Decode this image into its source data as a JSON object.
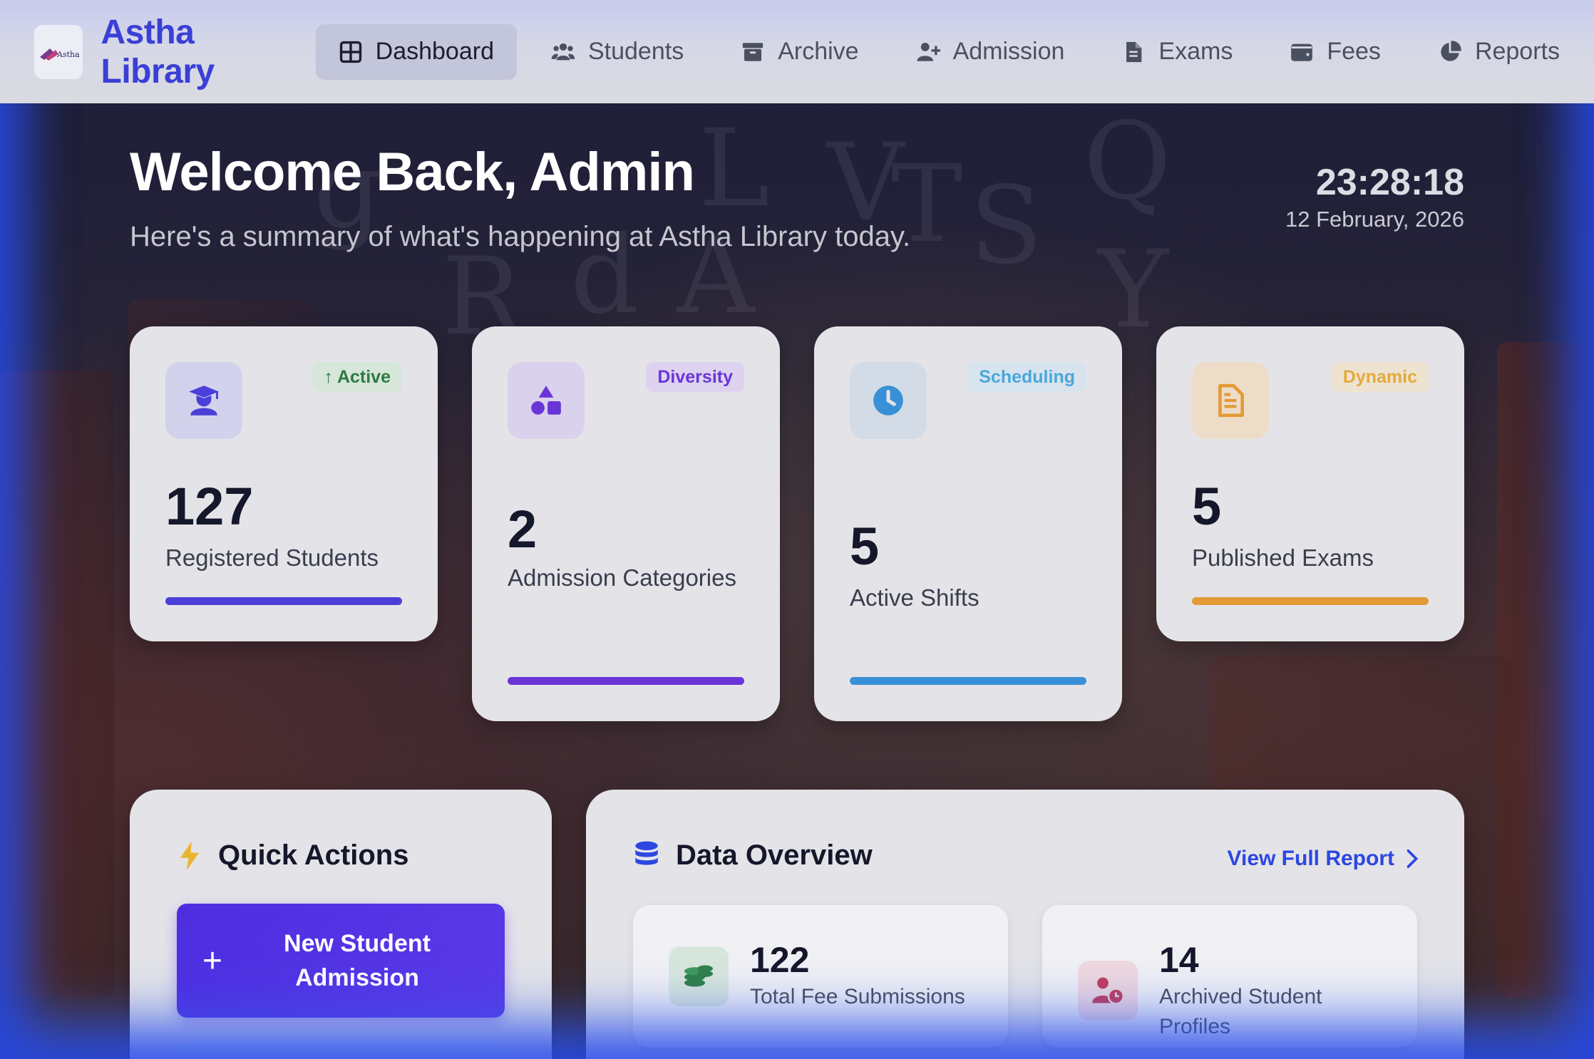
{
  "brand": {
    "name": "Astha Library",
    "logo_text": "Astha"
  },
  "nav": {
    "items": [
      {
        "label": "Dashboard",
        "icon": "dashboard-grid-icon",
        "active": true
      },
      {
        "label": "Students",
        "icon": "users-icon",
        "active": false
      },
      {
        "label": "Archive",
        "icon": "archive-box-icon",
        "active": false
      },
      {
        "label": "Admission",
        "icon": "user-plus-icon",
        "active": false
      },
      {
        "label": "Exams",
        "icon": "document-icon",
        "active": false
      },
      {
        "label": "Fees",
        "icon": "wallet-icon",
        "active": false
      },
      {
        "label": "Reports",
        "icon": "pie-chart-icon",
        "active": false
      }
    ]
  },
  "hero": {
    "title": "Welcome Back, Admin",
    "subtitle": "Here's a summary of what's happening at Astha Library today.",
    "time": "23:28:18",
    "date": "12 February, 2026"
  },
  "stats": [
    {
      "value": "127",
      "label": "Registered Students",
      "badge": "↑ Active",
      "icon": "graduate-icon",
      "accent": "#4b3fd9",
      "badge_color": "#2d7a43"
    },
    {
      "value": "2",
      "label": "Admission Categories",
      "badge": "Diversity",
      "icon": "shapes-icon",
      "accent": "#6a35d8",
      "badge_color": "#6a35d8"
    },
    {
      "value": "5",
      "label": "Active Shifts",
      "badge": "Scheduling",
      "icon": "clock-icon",
      "accent": "#3a90d6",
      "badge_color": "#4aa7dc"
    },
    {
      "value": "5",
      "label": "Published Exams",
      "badge": "Dynamic",
      "icon": "exam-document-icon",
      "accent": "#e39a35",
      "badge_color": "#e5a93c"
    }
  ],
  "quick_actions": {
    "title": "Quick Actions",
    "primary_button": "New Student Admission"
  },
  "overview": {
    "title": "Data Overview",
    "link": "View Full Report",
    "cards": [
      {
        "value": "122",
        "label": "Total Fee Submissions",
        "icon": "coins-icon"
      },
      {
        "value": "14",
        "label": "Archived Student Profiles",
        "icon": "user-clock-icon"
      }
    ]
  },
  "colors": {
    "brand": "#3a3fd6",
    "primary_button": "#4d2ee0",
    "link": "#2c47e0"
  }
}
